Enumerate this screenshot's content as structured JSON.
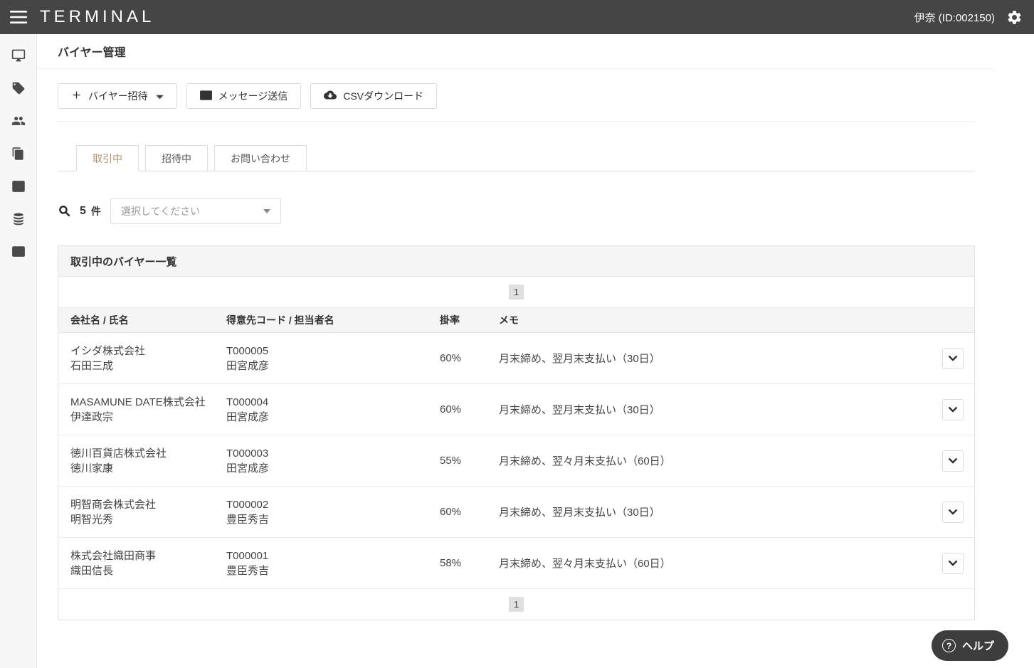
{
  "colors": {
    "header_bg": "#454545",
    "accent": "#b5936b"
  },
  "header": {
    "logo": "TERMINAL",
    "user": "伊奈 (ID:002150)"
  },
  "sidebar": {
    "items": [
      {
        "icon": "desktop-icon"
      },
      {
        "icon": "tag-icon"
      },
      {
        "icon": "users-icon"
      },
      {
        "icon": "copy-icon"
      },
      {
        "icon": "chart-line-icon"
      },
      {
        "icon": "database-icon"
      },
      {
        "icon": "newspaper-icon"
      }
    ]
  },
  "page": {
    "title": "バイヤー管理"
  },
  "toolbar": {
    "invite_label": "バイヤー招待",
    "message_label": "メッセージ送信",
    "csv_label": "CSVダウンロード"
  },
  "tabs": [
    {
      "label": "取引中",
      "active": true
    },
    {
      "label": "招待中",
      "active": false
    },
    {
      "label": "お問い合わせ",
      "active": false
    }
  ],
  "filter": {
    "count": "5",
    "count_unit": "件",
    "select_placeholder": "選択してください"
  },
  "panel": {
    "title": "取引中のバイヤー一覧",
    "pagination": "1",
    "columns": [
      "会社名 / 氏名",
      "得意先コード / 担当者名",
      "掛率",
      "メモ"
    ],
    "rows": [
      {
        "company": "イシダ株式会社",
        "person": "石田三成",
        "code": "T000005",
        "manager": "田宮成彦",
        "rate": "60%",
        "memo": "月末締め、翌月末支払い（30日）"
      },
      {
        "company": "MASAMUNE DATE株式会社",
        "person": "伊達政宗",
        "code": "T000004",
        "manager": "田宮成彦",
        "rate": "60%",
        "memo": "月末締め、翌月末支払い（30日）"
      },
      {
        "company": "徳川百貨店株式会社",
        "person": "徳川家康",
        "code": "T000003",
        "manager": "田宮成彦",
        "rate": "55%",
        "memo": "月末締め、翌々月末支払い（60日）"
      },
      {
        "company": "明智商会株式会社",
        "person": "明智光秀",
        "code": "T000002",
        "manager": "豊臣秀吉",
        "rate": "60%",
        "memo": "月末締め、翌月末支払い（30日）"
      },
      {
        "company": "株式会社織田商事",
        "person": "織田信長",
        "code": "T000001",
        "manager": "豊臣秀吉",
        "rate": "58%",
        "memo": "月末締め、翌々月末支払い（60日）"
      }
    ]
  },
  "help": {
    "label": "ヘルプ"
  }
}
